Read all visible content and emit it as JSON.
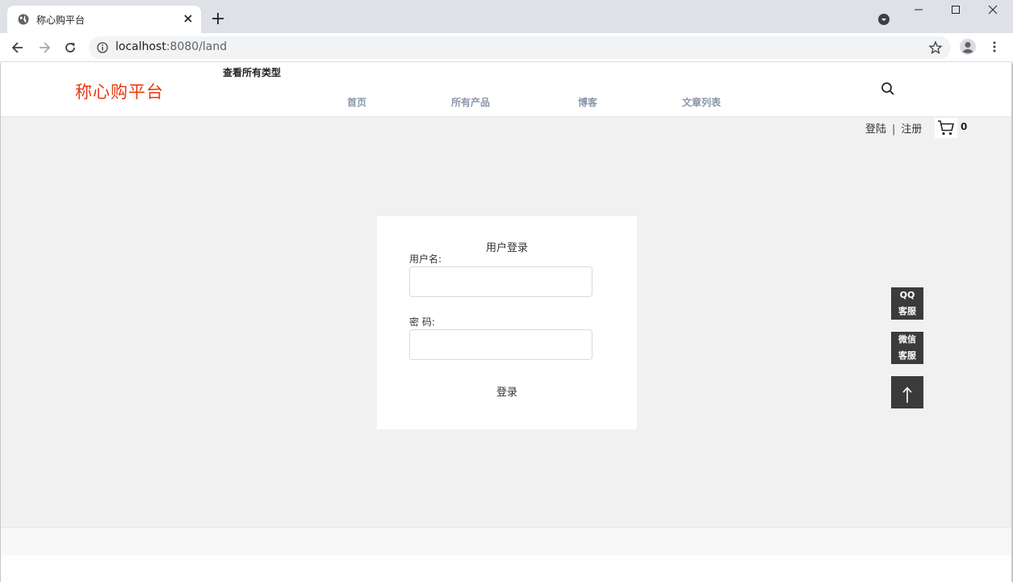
{
  "browser": {
    "tab_title": "称心购平台",
    "url_host": "localhost",
    "url_rest": ":8080/land"
  },
  "header": {
    "logo": "称心购平台",
    "all_types": "查看所有类型",
    "nav": [
      "首页",
      "所有产品",
      "博客",
      "文章列表"
    ]
  },
  "user_bar": {
    "login": "登陆",
    "separator": "|",
    "register": "注册",
    "cart_count": "0"
  },
  "login_form": {
    "title": "用户登录",
    "username_label": "用户名:",
    "username_value": "",
    "password_label": "密 码:",
    "password_value": "",
    "submit": "登录"
  },
  "side_tools": {
    "qq": [
      "QQ",
      "客服"
    ],
    "wechat": [
      "微信",
      "客服"
    ]
  },
  "colors": {
    "logo": "#e8380d",
    "nav": "#8a98a9",
    "content_bg": "#f1f1f1",
    "side_btn": "#3b3b3b"
  }
}
